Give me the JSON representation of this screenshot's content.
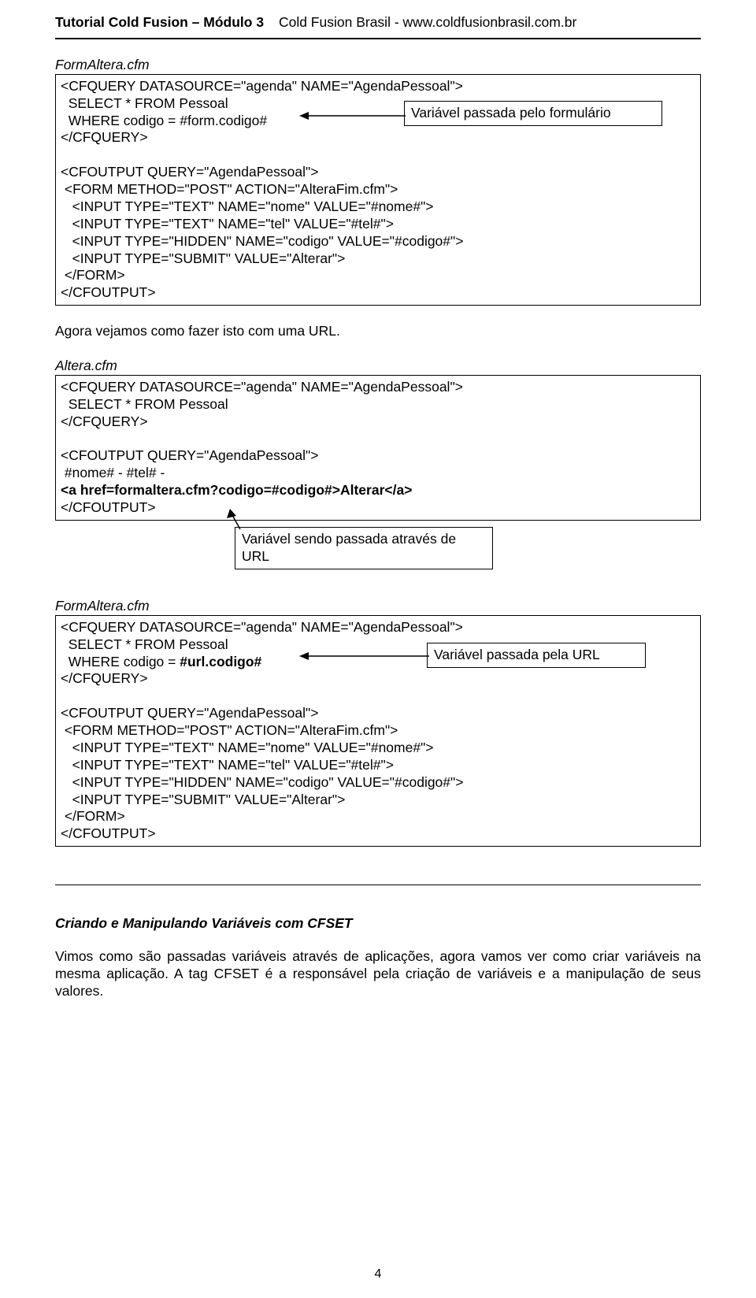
{
  "header": {
    "title": "Tutorial Cold Fusion – Módulo 3",
    "subtitle": "Cold Fusion Brasil - www.coldfusionbrasil.com.br"
  },
  "file1": "FormAltera.cfm",
  "code1": "<CFQUERY DATASOURCE=\"agenda\" NAME=\"AgendaPessoal\">\n  SELECT * FROM Pessoal\n  WHERE codigo = #form.codigo#\n</CFQUERY>\n\n<CFOUTPUT QUERY=\"AgendaPessoal\">\n <FORM METHOD=\"POST\" ACTION=\"AlteraFim.cfm\">\n   <INPUT TYPE=\"TEXT\" NAME=\"nome\" VALUE=\"#nome#\">\n   <INPUT TYPE=\"TEXT\" NAME=\"tel\" VALUE=\"#tel#\">\n   <INPUT TYPE=\"HIDDEN\" NAME=\"codigo\" VALUE=\"#codigo#\">\n   <INPUT TYPE=\"SUBMIT\" VALUE=\"Alterar\">\n </FORM>\n</CFOUTPUT>",
  "callout1": "Variável passada pelo formulário",
  "para1": "Agora vejamos como fazer isto com uma URL.",
  "file2": "Altera.cfm",
  "code2a": "<CFQUERY DATASOURCE=\"agenda\" NAME=\"AgendaPessoal\">\n  SELECT * FROM Pessoal\n</CFQUERY>\n\n<CFOUTPUT QUERY=\"AgendaPessoal\">\n #nome# - #tel# -\n",
  "code2b_bold": "<a href=formaltera.cfm?codigo=#codigo#>Alterar</a>",
  "code2c": "\n</CFOUTPUT>",
  "callout2": "Variável sendo passada através de URL",
  "file3": "FormAltera.cfm",
  "code3a": "<CFQUERY DATASOURCE=\"agenda\" NAME=\"AgendaPessoal\">\n  SELECT * FROM Pessoal\n  WHERE codigo = ",
  "code3a_bold": "#url.codigo#",
  "code3b": "\n</CFQUERY>\n\n<CFOUTPUT QUERY=\"AgendaPessoal\">\n <FORM METHOD=\"POST\" ACTION=\"AlteraFim.cfm\">\n   <INPUT TYPE=\"TEXT\" NAME=\"nome\" VALUE=\"#nome#\">\n   <INPUT TYPE=\"TEXT\" NAME=\"tel\" VALUE=\"#tel#\">\n   <INPUT TYPE=\"HIDDEN\" NAME=\"codigo\" VALUE=\"#codigo#\">\n   <INPUT TYPE=\"SUBMIT\" VALUE=\"Alterar\">\n </FORM>\n</CFOUTPUT>",
  "callout3": "Variável passada pela URL",
  "section_title": "Criando e Manipulando Variáveis com CFSET",
  "para2": "Vimos como são passadas variáveis através de aplicações, agora vamos ver como criar variáveis na mesma aplicação. A tag CFSET é a responsável pela criação de variáveis e a manipulação de seus valores.",
  "pagenum": "4"
}
